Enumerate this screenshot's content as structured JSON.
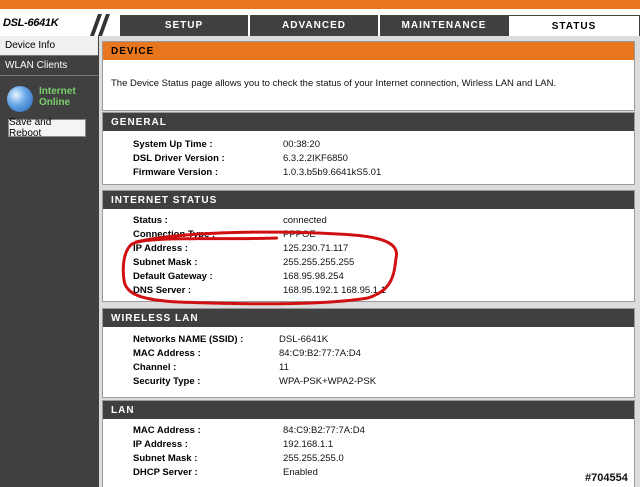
{
  "brand": {
    "model": "DSL-6641K"
  },
  "tabs": [
    {
      "label": "SETUP"
    },
    {
      "label": "ADVANCED"
    },
    {
      "label": "MAINTENANCE"
    },
    {
      "label": "STATUS"
    }
  ],
  "sidebar": {
    "items": [
      {
        "label": "Device Info"
      },
      {
        "label": "WLAN Clients"
      }
    ],
    "net_status_line1": "Internet",
    "net_status_line2": "Online",
    "reboot_label": "Save and Reboot"
  },
  "device": {
    "title": "DEVICE",
    "description": "The Device Status page allows you to check the status of your Internet connection, Wirless LAN and LAN."
  },
  "general": {
    "title": "GENERAL",
    "rows": [
      {
        "label": "System Up Time :",
        "value": "00:38:20"
      },
      {
        "label": "DSL Driver Version :",
        "value": "6.3.2.2IKF6850"
      },
      {
        "label": "Firmware Version :",
        "value": "1.0.3.b5b9.6641kS5.01"
      }
    ]
  },
  "internet": {
    "title": "INTERNET STATUS",
    "rows": [
      {
        "label": "Status :",
        "value": "connected"
      },
      {
        "label": "Connection Type :",
        "value": "PPPOE"
      },
      {
        "label": "IP Address :",
        "value": "125.230.71.117"
      },
      {
        "label": "Subnet Mask :",
        "value": "255.255.255.255"
      },
      {
        "label": "Default Gateway :",
        "value": "168.95.98.254"
      },
      {
        "label": "DNS Server :",
        "value": "168.95.192.1 168.95.1.1"
      }
    ]
  },
  "wlan": {
    "title": "WIRELESS LAN",
    "rows": [
      {
        "label": "Networks NAME (SSID) :",
        "value": "DSL-6641K"
      },
      {
        "label": "MAC Address :",
        "value": "84:C9:B2:77:7A:D4"
      },
      {
        "label": "Channel :",
        "value": "11"
      },
      {
        "label": "Security Type :",
        "value": "WPA-PSK+WPA2-PSK"
      }
    ]
  },
  "lan": {
    "title": "LAN",
    "rows": [
      {
        "label": "MAC Address :",
        "value": "84:C9:B2:77:7A:D4"
      },
      {
        "label": "IP Address :",
        "value": "192.168.1.1"
      },
      {
        "label": "Subnet Mask :",
        "value": "255.255.255.0"
      },
      {
        "label": "DHCP Server :",
        "value": "Enabled"
      }
    ]
  },
  "watermark": "#704554",
  "colors": {
    "accent": "#e8761e",
    "dark": "#404040",
    "annotation": "#d01010"
  }
}
